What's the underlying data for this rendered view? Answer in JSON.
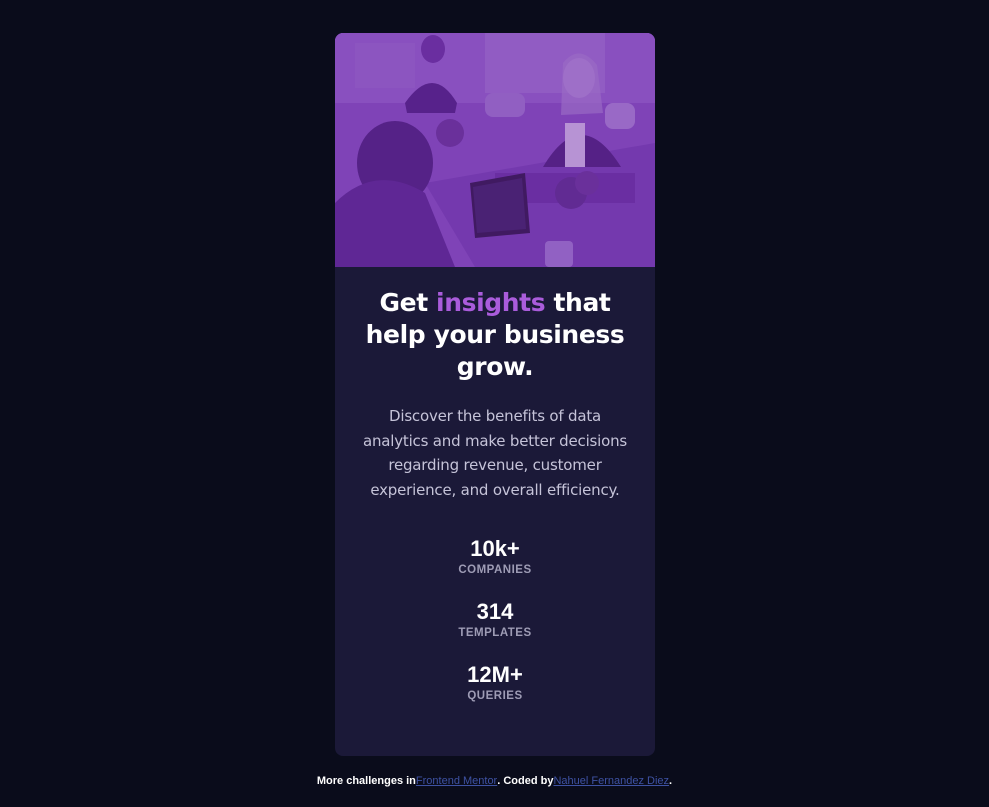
{
  "card": {
    "hero_image": {
      "overlay_color": "#6a2fa0",
      "description_icon": "office-meeting-image"
    },
    "title": {
      "before": "Get ",
      "accent": "insights",
      "after": " that help your business grow."
    },
    "description": "Discover the benefits of data analytics and make better decisions regarding revenue, customer experience, and overall efficiency.",
    "stats": [
      {
        "value": "10k+",
        "label": "COMPANIES"
      },
      {
        "value": "314",
        "label": "TEMPLATES"
      },
      {
        "value": "12M+",
        "label": "QUERIES"
      }
    ]
  },
  "footer": {
    "prefix": "More challenges in",
    "link1": "Frontend Mentor",
    "middle": ". Coded by",
    "link2": "Nahuel Fernandez Diez",
    "suffix": "."
  },
  "colors": {
    "page_bg": "#0a0c1b",
    "card_bg": "#1b1938",
    "accent": "#aa5cdb",
    "link": "#3e52a3"
  }
}
